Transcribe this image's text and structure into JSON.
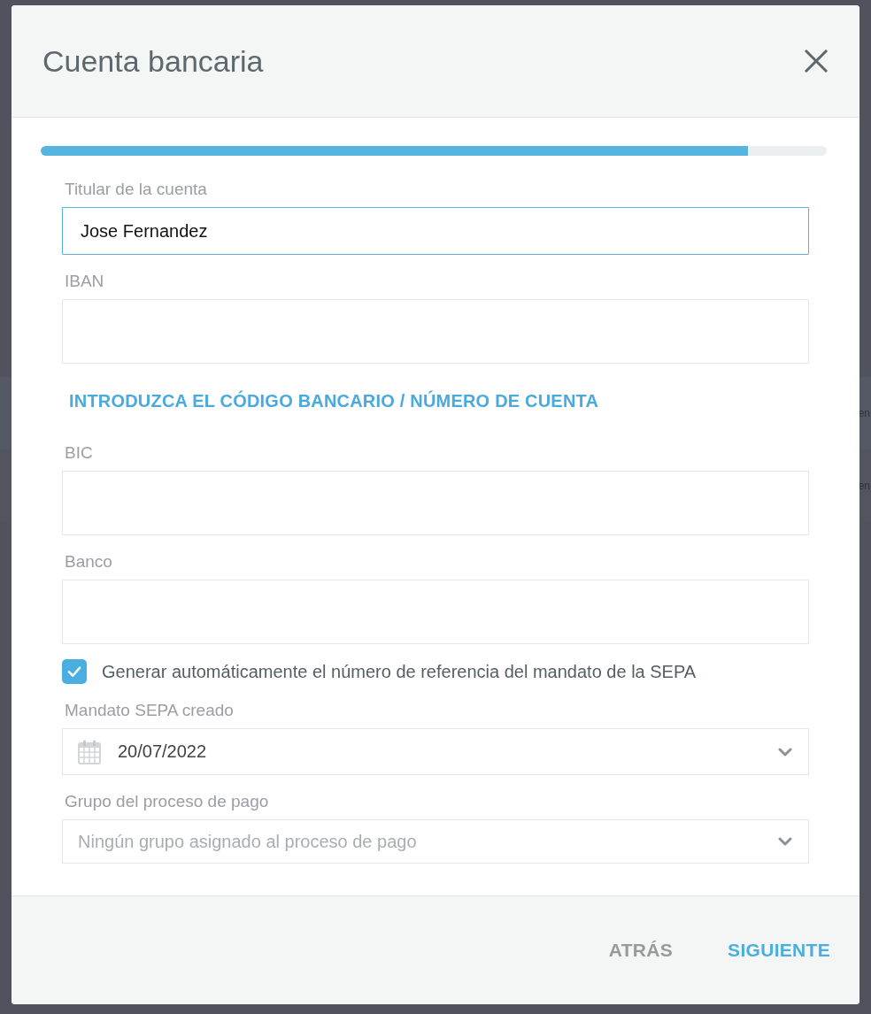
{
  "backdrop": {
    "texts": [
      "en",
      "en"
    ]
  },
  "dialog": {
    "title": "Cuenta bancaria"
  },
  "progress": {
    "level": 0.9
  },
  "fields": [
    {
      "kind": "text",
      "label": "Titular de la cuenta",
      "value": "Jose Fernandez",
      "focused": true
    },
    {
      "kind": "text",
      "label": "IBAN",
      "focused": false
    },
    {
      "kind": "link",
      "text": "INTRODUZCA EL CÓDIGO BANCARIO / NÚMERO DE CUENTA"
    },
    {
      "kind": "text",
      "label": "BIC",
      "focused": false
    },
    {
      "kind": "text",
      "label": "Banco",
      "focused": false
    },
    {
      "kind": "checkbox",
      "label": "Generar automáticamente el número de referencia del mandato de la SEPA",
      "checked": true
    },
    {
      "kind": "date",
      "label": "Mandato SEPA creado",
      "value": "20/07/2022"
    },
    {
      "kind": "select",
      "label": "Grupo del proceso de pago",
      "placeholder": "Ningún grupo asignado al proceso de pago"
    }
  ],
  "buttons": [
    {
      "label": "ATRÁS",
      "kind": "secondary"
    },
    {
      "label": "SIGUIENTE",
      "kind": "primary"
    }
  ]
}
